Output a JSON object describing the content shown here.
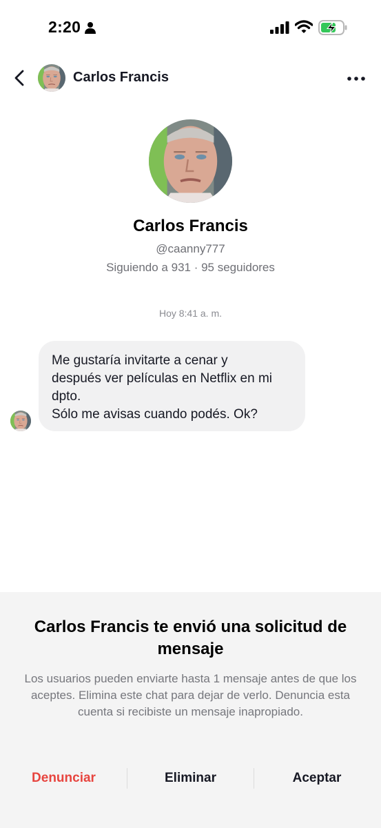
{
  "status_bar": {
    "time": "2:20",
    "icons": [
      "person-icon",
      "signal-icon",
      "wifi-icon",
      "battery-charging-icon"
    ],
    "battery_color": "#34c759"
  },
  "header": {
    "title": "Carlos Francis",
    "icons": [
      "back-arrow-icon",
      "more-options-icon"
    ]
  },
  "profile": {
    "name": "Carlos Francis",
    "handle": "@caanny777",
    "stats": "Siguiendo a 931 · 95 seguidores"
  },
  "chat": {
    "timestamp": "Hoy 8:41 a. m.",
    "messages": [
      {
        "text": "Me gustaría invitarte a cenar y\ndespués ver películas en Netflix en mi\ndpto.\nSólo me avisas cuando podés. Ok?"
      }
    ]
  },
  "request_sheet": {
    "title": "Carlos Francis te envió una solicitud de mensaje",
    "body": "Los usuarios pueden enviarte hasta 1 mensaje antes de que los aceptes. Elimina este chat para dejar de verlo. Denuncia esta cuenta si recibiste un mensaje inapropiado.",
    "actions": {
      "report": "Denunciar",
      "delete": "Eliminar",
      "accept": "Aceptar"
    },
    "report_color": "#e7453f"
  }
}
